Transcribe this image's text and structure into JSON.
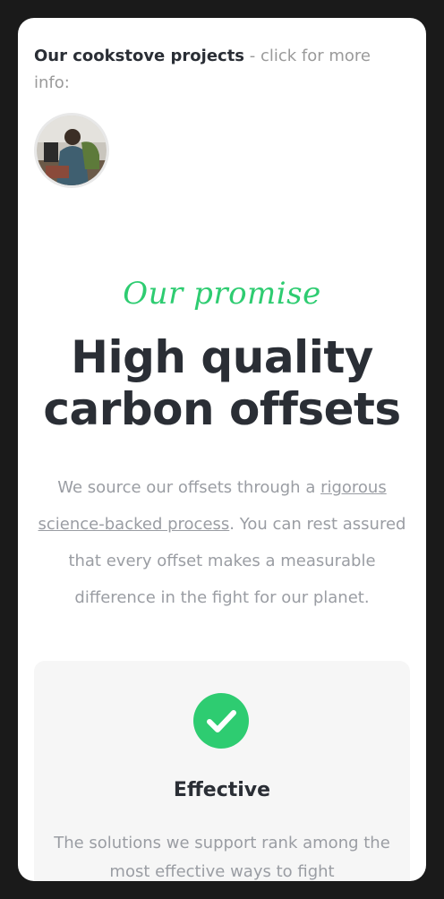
{
  "projects": {
    "title": "Our cookstove projects",
    "suffix": " - click for more info:"
  },
  "promise": {
    "kicker": "Our promise",
    "headline_line1": "High quality",
    "headline_line2": "carbon offsets",
    "body_before": "We source our offsets through a ",
    "body_link": "rigorous science-backed process",
    "body_after": ". You can rest assured that every offset makes a measurable difference in the fight for our planet."
  },
  "card": {
    "icon": "check-circle-icon",
    "title": "Effective",
    "text": "The solutions we support rank among the most effective ways to fight"
  },
  "colors": {
    "accent": "#2ecc71",
    "heading": "#2a2e35",
    "body": "#9a9da3"
  }
}
